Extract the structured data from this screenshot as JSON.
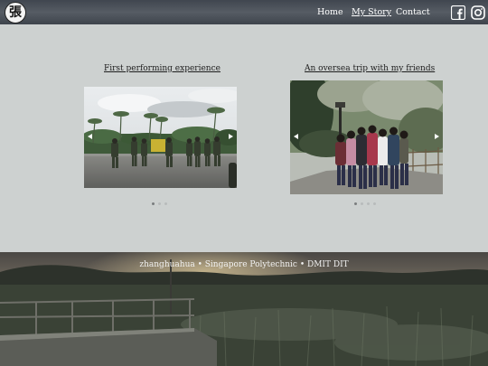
{
  "header": {
    "logo_text": "張",
    "nav": [
      {
        "label": "Home",
        "active": false
      },
      {
        "label": "My Story",
        "active": true
      },
      {
        "label": "Contact",
        "active": false
      }
    ],
    "social_icons": [
      "facebook-icon",
      "instagram-icon"
    ]
  },
  "cards": [
    {
      "title": "First performing experience",
      "slides_count": 3,
      "active_slide": 1
    },
    {
      "title": "An oversea trip with my friends",
      "slides_count": 4,
      "active_slide": 1
    }
  ],
  "footer": {
    "caption": "zhanghuahua • Singapore Polytechnic • DMIT DIT"
  },
  "colors": {
    "page_background": "#cdd1d0",
    "header_background": "#4b5159",
    "nav_text": "#ffffff",
    "title_text": "#1e1e1e"
  }
}
